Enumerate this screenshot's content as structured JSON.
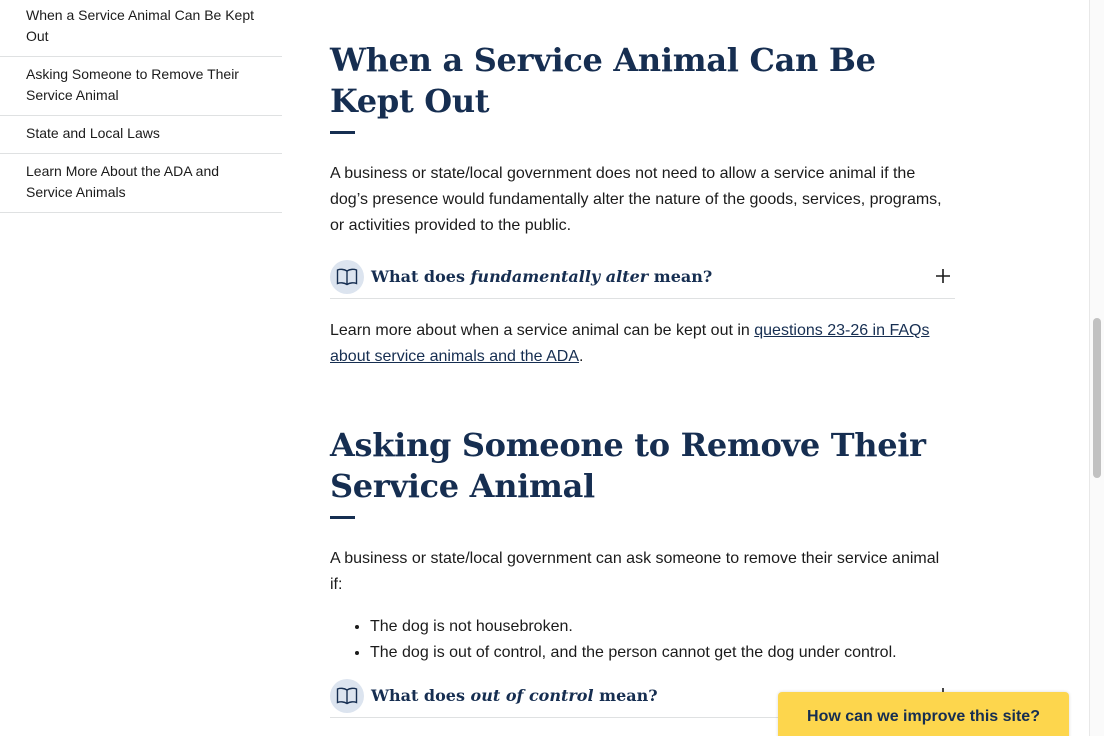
{
  "sidenav": {
    "items": [
      {
        "label": "When a Service Animal Can Be Kept Out"
      },
      {
        "label": "Asking Someone to Remove Their Service Animal"
      },
      {
        "label": "State and Local Laws"
      },
      {
        "label": "Learn More About the ADA and Service Animals"
      }
    ]
  },
  "sections": {
    "kept_out": {
      "heading": "When a Service Animal Can Be Kept Out",
      "body": "A business or state/local government does not need to allow a service animal if the dog’s presence would fundamentally alter the nature of the goods, services, programs, or activities provided to the public.",
      "accordion": {
        "prefix": "What does ",
        "term": "fundamentally alter",
        "suffix": " mean?"
      },
      "learn_more_text": "Learn more about when a service animal can be kept out in ",
      "learn_more_link": "questions 23-26 in FAQs about service animals and the ADA",
      "learn_more_end": "."
    },
    "remove": {
      "heading": "Asking Someone to Remove Their Service Animal",
      "body": "A business or state/local government can ask someone to remove their service animal if:",
      "bullets": [
        "The dog is not housebroken.",
        "The dog is out of control, and the person cannot get the dog under control."
      ],
      "accordion": {
        "prefix": "What does ",
        "term": "out of control",
        "suffix": " mean?"
      }
    }
  },
  "feedback": {
    "label": "How can we improve this site?"
  },
  "icons": {
    "accordion_icon": "book-open-icon",
    "expand_icon": "plus-icon"
  },
  "colors": {
    "heading": "#162e51",
    "feedback_bg": "#fdd64d",
    "icon_circle": "#dce4ef"
  }
}
